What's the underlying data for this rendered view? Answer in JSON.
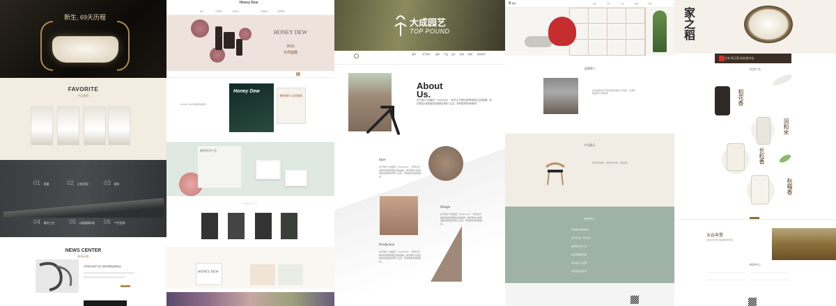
{
  "panel1": {
    "hero_text": "新生, 69天历程",
    "favorite_title": "FAVORITE",
    "favorite_sub": "产品推荐",
    "stats": [
      {
        "num": "01",
        "label": "用量"
      },
      {
        "num": "02",
        "label": "立体匹配"
      },
      {
        "num": "03",
        "label": "面料"
      },
      {
        "num": "04",
        "label": "填充工艺"
      },
      {
        "num": "05",
        "label": "A类健康标准"
      },
      {
        "num": "06",
        "label": "个性定制"
      }
    ],
    "news_title": "NEWS CENTER",
    "news_sub": "新闻动态",
    "news_text": "宣传我们的新产品介绍和详细的品牌信息"
  },
  "panel2": {
    "logo": "Honey Dew",
    "nav": [
      "首页",
      "关于我们",
      "产品中心",
      "新闻中心",
      "联系我们"
    ],
    "hero_title": "HONEY DEW",
    "hero_year": "2016",
    "hero_cn": "天然面膜",
    "book_title": "Honey Dew",
    "book2": "植物精华 自然美肌",
    "side_text": "HONEY DEW 蜂蜜护肤系列",
    "mint_title": "蜜帆系列产品",
    "prod_title": "PRODUCT",
    "honeydew_label": "HONEY DEW"
  },
  "panel3": {
    "hero_cn": "大成园艺",
    "hero_en": "TOP POUND",
    "nav": [
      "首页",
      "关于我们",
      "品牌",
      "产品",
      "设计",
      "案例",
      "新闻",
      "联系我们"
    ],
    "about": "About Us.",
    "about_text": "关于我们 大成园艺（TopPound）一家专注于提供自然和家居生活的品牌。我们希望以最真诚的态度把自然带入生活，带来更多舒适和美好。",
    "style_label": "Style",
    "design_label": "Design",
    "production_label": "Production"
  },
  "panel4": {
    "logo": "S",
    "brand": "家具",
    "nav": [
      "首页",
      "关于",
      "产品",
      "案例",
      "联系"
    ],
    "section_about": "品牌简介",
    "section_product": "产品展示",
    "section_news": "新闻中心",
    "about_text": "家具品牌专注于现代简约风格设计与制造，追求极致品质与舒适体验。",
    "product_text": "简约实木餐椅，北欧设计风格，舒适耐用。",
    "news_items": [
      "新品发布会圆满成功",
      "设计师访谈：现代家居",
      "品牌荣获设计大奖",
      "展会现场精彩回顾",
      "秋冬新品上市通知",
      "家居搭配灵感分享"
    ]
  },
  "panel5": {
    "brush_title": "家之稻",
    "banner_text": "五常大米 家之稻 粒粒皆辛苦",
    "section_products": "优质产品",
    "prod1": "稻花香",
    "prod2": "润和米",
    "prod3": "长粒香",
    "prod4": "秋糯香",
    "farm_title": "五谷丰登",
    "news_title": "新闻中心"
  },
  "colors": {
    "gold": "#b08e4d",
    "red_chair": "#c62d2e",
    "sage": "#9fb2a6"
  }
}
